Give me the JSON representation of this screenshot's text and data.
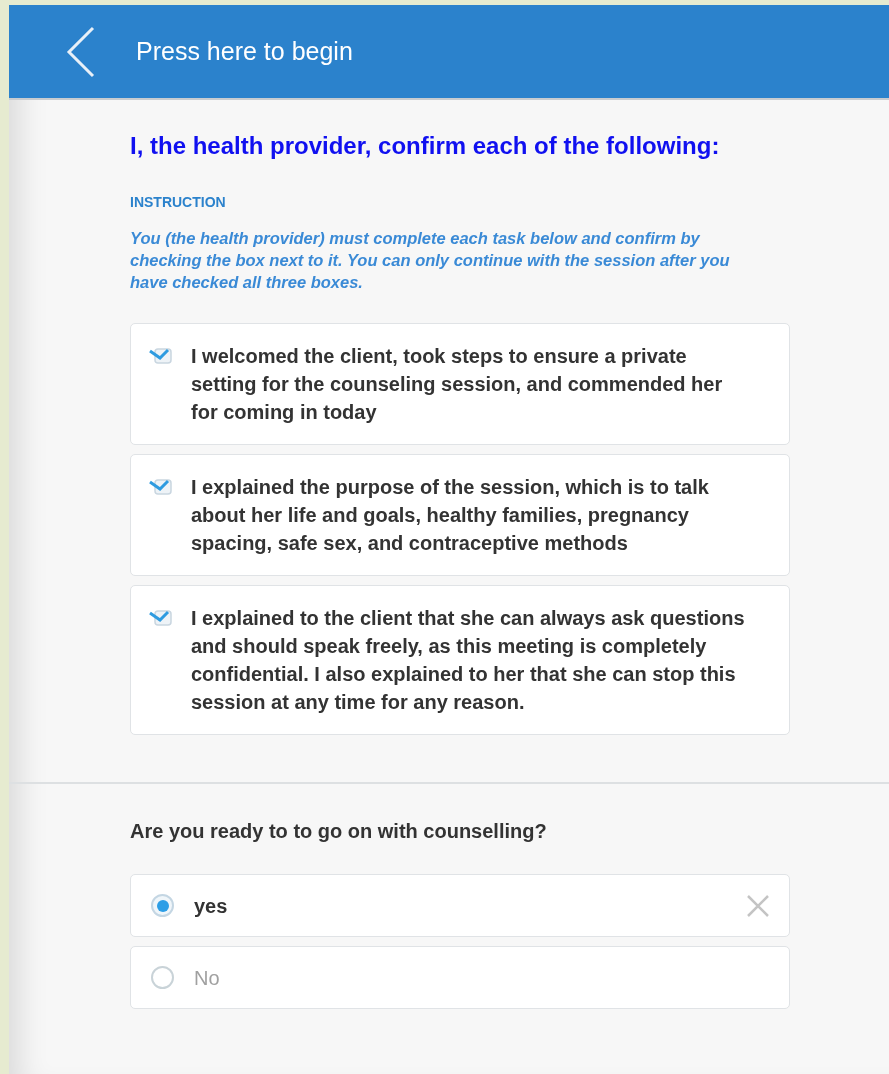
{
  "header": {
    "title": "Press here to begin"
  },
  "heading": "I, the health provider, confirm each of the following:",
  "instruction": {
    "label": "INSTRUCTION",
    "text": "You (the health provider) must complete each task below and confirm by checking the box next to it. You can only continue with the session after you have checked all three boxes."
  },
  "tasks": [
    {
      "text": "I welcomed the client, took steps to ensure a private setting for the counseling session, and commended her for coming in today",
      "checked": true
    },
    {
      "text": "I explained the purpose of the session, which is to talk about her life and goals, healthy families, pregnancy spacing, safe sex, and contraceptive methods",
      "checked": true
    },
    {
      "text": "I explained to the client that she can always ask questions and should speak freely, as this meeting is completely confidential. I also explained to her that she can stop this session at any time for any reason.",
      "checked": true
    }
  ],
  "question": {
    "label": "Are you ready to to go on with counselling?",
    "options": [
      {
        "label": "yes",
        "selected": true
      },
      {
        "label": "No",
        "selected": false
      }
    ]
  }
}
